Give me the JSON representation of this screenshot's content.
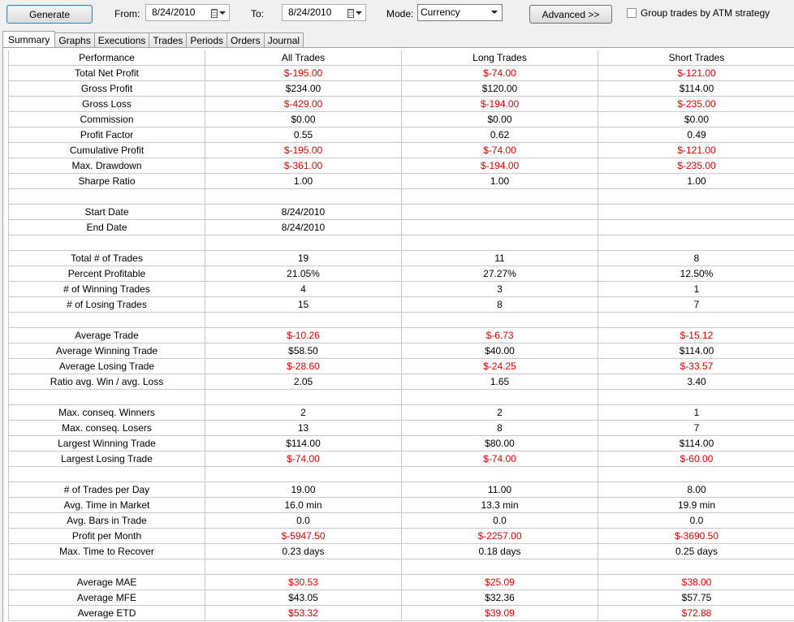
{
  "toolbar": {
    "generate_label": "Generate",
    "from_label": "From:",
    "from_date": "8/24/2010",
    "to_label": "To:",
    "to_date": "8/24/2010",
    "mode_label": "Mode:",
    "mode_value": "Currency",
    "advanced_label": "Advanced >>",
    "group_trades_label": "Group trades by ATM strategy",
    "group_trades_checked": false
  },
  "tabs": [
    {
      "label": "Summary",
      "active": true
    },
    {
      "label": "Graphs",
      "active": false
    },
    {
      "label": "Executions",
      "active": false
    },
    {
      "label": "Trades",
      "active": false
    },
    {
      "label": "Periods",
      "active": false
    },
    {
      "label": "Orders",
      "active": false
    },
    {
      "label": "Journal",
      "active": false
    }
  ],
  "colors": {
    "negative": "#e00000",
    "grid_line": "#c8c8c8"
  },
  "table": {
    "headers": [
      "Performance",
      "All Trades",
      "Long Trades",
      "Short Trades"
    ],
    "rows": [
      {
        "label": "Total Net Profit",
        "values": [
          "$-195.00",
          "$-74.00",
          "$-121.00"
        ],
        "red": true
      },
      {
        "label": "Gross Profit",
        "values": [
          "$234.00",
          "$120.00",
          "$114.00"
        ]
      },
      {
        "label": "Gross Loss",
        "values": [
          "$-429.00",
          "$-194.00",
          "$-235.00"
        ],
        "red": true
      },
      {
        "label": "Commission",
        "values": [
          "$0.00",
          "$0.00",
          "$0.00"
        ]
      },
      {
        "label": "Profit Factor",
        "values": [
          "0.55",
          "0.62",
          "0.49"
        ]
      },
      {
        "label": "Cumulative Profit",
        "values": [
          "$-195.00",
          "$-74.00",
          "$-121.00"
        ],
        "red": true
      },
      {
        "label": "Max. Drawdown",
        "values": [
          "$-361.00",
          "$-194.00",
          "$-235.00"
        ],
        "red": true
      },
      {
        "label": "Sharpe Ratio",
        "values": [
          "1.00",
          "1.00",
          "1.00"
        ]
      },
      {
        "label": "",
        "values": [
          "",
          "",
          ""
        ]
      },
      {
        "label": "Start Date",
        "values": [
          "8/24/2010",
          "",
          ""
        ]
      },
      {
        "label": "End Date",
        "values": [
          "8/24/2010",
          "",
          ""
        ]
      },
      {
        "label": "",
        "values": [
          "",
          "",
          ""
        ]
      },
      {
        "label": "Total # of Trades",
        "values": [
          "19",
          "11",
          "8"
        ]
      },
      {
        "label": "Percent Profitable",
        "values": [
          "21.05%",
          "27.27%",
          "12.50%"
        ]
      },
      {
        "label": "# of Winning Trades",
        "values": [
          "4",
          "3",
          "1"
        ]
      },
      {
        "label": "# of Losing Trades",
        "values": [
          "15",
          "8",
          "7"
        ]
      },
      {
        "label": "",
        "values": [
          "",
          "",
          ""
        ]
      },
      {
        "label": "Average Trade",
        "values": [
          "$-10.26",
          "$-6.73",
          "$-15.12"
        ],
        "red": true
      },
      {
        "label": "Average Winning Trade",
        "values": [
          "$58.50",
          "$40.00",
          "$114.00"
        ]
      },
      {
        "label": "Average Losing Trade",
        "values": [
          "$-28.60",
          "$-24.25",
          "$-33.57"
        ],
        "red": true
      },
      {
        "label": "Ratio avg. Win / avg. Loss",
        "values": [
          "2.05",
          "1.65",
          "3.40"
        ]
      },
      {
        "label": "",
        "values": [
          "",
          "",
          ""
        ]
      },
      {
        "label": "Max. conseq. Winners",
        "values": [
          "2",
          "2",
          "1"
        ]
      },
      {
        "label": "Max. conseq. Losers",
        "values": [
          "13",
          "8",
          "7"
        ]
      },
      {
        "label": "Largest Winning Trade",
        "values": [
          "$114.00",
          "$80.00",
          "$114.00"
        ]
      },
      {
        "label": "Largest Losing Trade",
        "values": [
          "$-74.00",
          "$-74.00",
          "$-60.00"
        ],
        "red": true
      },
      {
        "label": "",
        "values": [
          "",
          "",
          ""
        ]
      },
      {
        "label": "# of Trades per Day",
        "values": [
          "19.00",
          "11.00",
          "8.00"
        ]
      },
      {
        "label": "Avg. Time in Market",
        "values": [
          "16.0 min",
          "13.3 min",
          "19.9 min"
        ]
      },
      {
        "label": "Avg. Bars in Trade",
        "values": [
          "0.0",
          "0.0",
          "0.0"
        ]
      },
      {
        "label": "Profit per Month",
        "values": [
          "$-5947.50",
          "$-2257.00",
          "$-3690.50"
        ],
        "red": true
      },
      {
        "label": "Max. Time to Recover",
        "values": [
          "0.23 days",
          "0.18 days",
          "0.25 days"
        ]
      },
      {
        "label": "",
        "values": [
          "",
          "",
          ""
        ]
      },
      {
        "label": "Average MAE",
        "values": [
          "$30.53",
          "$25.09",
          "$38.00"
        ],
        "red": true
      },
      {
        "label": "Average MFE",
        "values": [
          "$43.05",
          "$32.36",
          "$57.75"
        ]
      },
      {
        "label": "Average ETD",
        "values": [
          "$53.32",
          "$39.09",
          "$72.88"
        ],
        "red": true
      }
    ]
  }
}
